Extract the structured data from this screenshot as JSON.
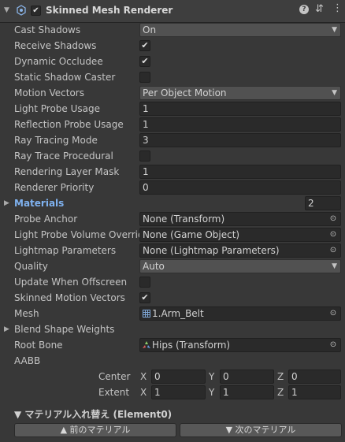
{
  "header": {
    "title": "Skinned Mesh Renderer",
    "enabled": true,
    "icons": [
      "collapse-arrow-icon",
      "component-icon",
      "help-icon",
      "presets-icon",
      "context-menu-icon"
    ]
  },
  "props": {
    "cast_shadows": {
      "label": "Cast Shadows",
      "value": "On"
    },
    "receive_shadows": {
      "label": "Receive Shadows",
      "checked": true
    },
    "dynamic_occludee": {
      "label": "Dynamic Occludee",
      "checked": true
    },
    "static_shadow_caster": {
      "label": "Static Shadow Caster",
      "checked": false
    },
    "motion_vectors": {
      "label": "Motion Vectors",
      "value": "Per Object Motion"
    },
    "light_probe_usage": {
      "label": "Light Probe Usage",
      "value": "1"
    },
    "reflection_probe_usage": {
      "label": "Reflection Probe Usage",
      "value": "1"
    },
    "ray_tracing_mode": {
      "label": "Ray Tracing Mode",
      "value": "3"
    },
    "ray_trace_procedural": {
      "label": "Ray Trace Procedural",
      "checked": false
    },
    "rendering_layer_mask": {
      "label": "Rendering Layer Mask",
      "value": "1"
    },
    "renderer_priority": {
      "label": "Renderer Priority",
      "value": "0"
    },
    "materials": {
      "label": "Materials",
      "count": "2"
    },
    "probe_anchor": {
      "label": "Probe Anchor",
      "value": "None (Transform)"
    },
    "light_probe_volume_override": {
      "label": "Light Probe Volume Override",
      "value": "None (Game Object)"
    },
    "lightmap_parameters": {
      "label": "Lightmap Parameters",
      "value": "None (Lightmap Parameters)"
    },
    "quality": {
      "label": "Quality",
      "value": "Auto"
    },
    "update_when_offscreen": {
      "label": "Update When Offscreen",
      "checked": false
    },
    "skinned_motion_vectors": {
      "label": "Skinned Motion Vectors",
      "checked": true
    },
    "mesh": {
      "label": "Mesh",
      "value": "1.Arm_Belt"
    },
    "blend_shape_weights": {
      "label": "Blend Shape Weights"
    },
    "root_bone": {
      "label": "Root Bone",
      "value": "Hips (Transform)"
    },
    "aabb": {
      "label": "AABB"
    }
  },
  "bounds": {
    "center": {
      "label": "Center",
      "x": "0",
      "y": "0",
      "z": "0"
    },
    "extent": {
      "label": "Extent",
      "x": "1",
      "y": "1",
      "z": "1"
    },
    "axis": {
      "x": "X",
      "y": "Y",
      "z": "Z"
    }
  },
  "swap": {
    "title": "▼ マテリアル入れ替え (Element0)",
    "prev_label": "▲ 前のマテリアル",
    "next_label": "▼ 次のマテリアル"
  },
  "colors": {
    "accent_link": "#7fb2f0",
    "panel": "#383838",
    "field": "#2a2a2a"
  }
}
